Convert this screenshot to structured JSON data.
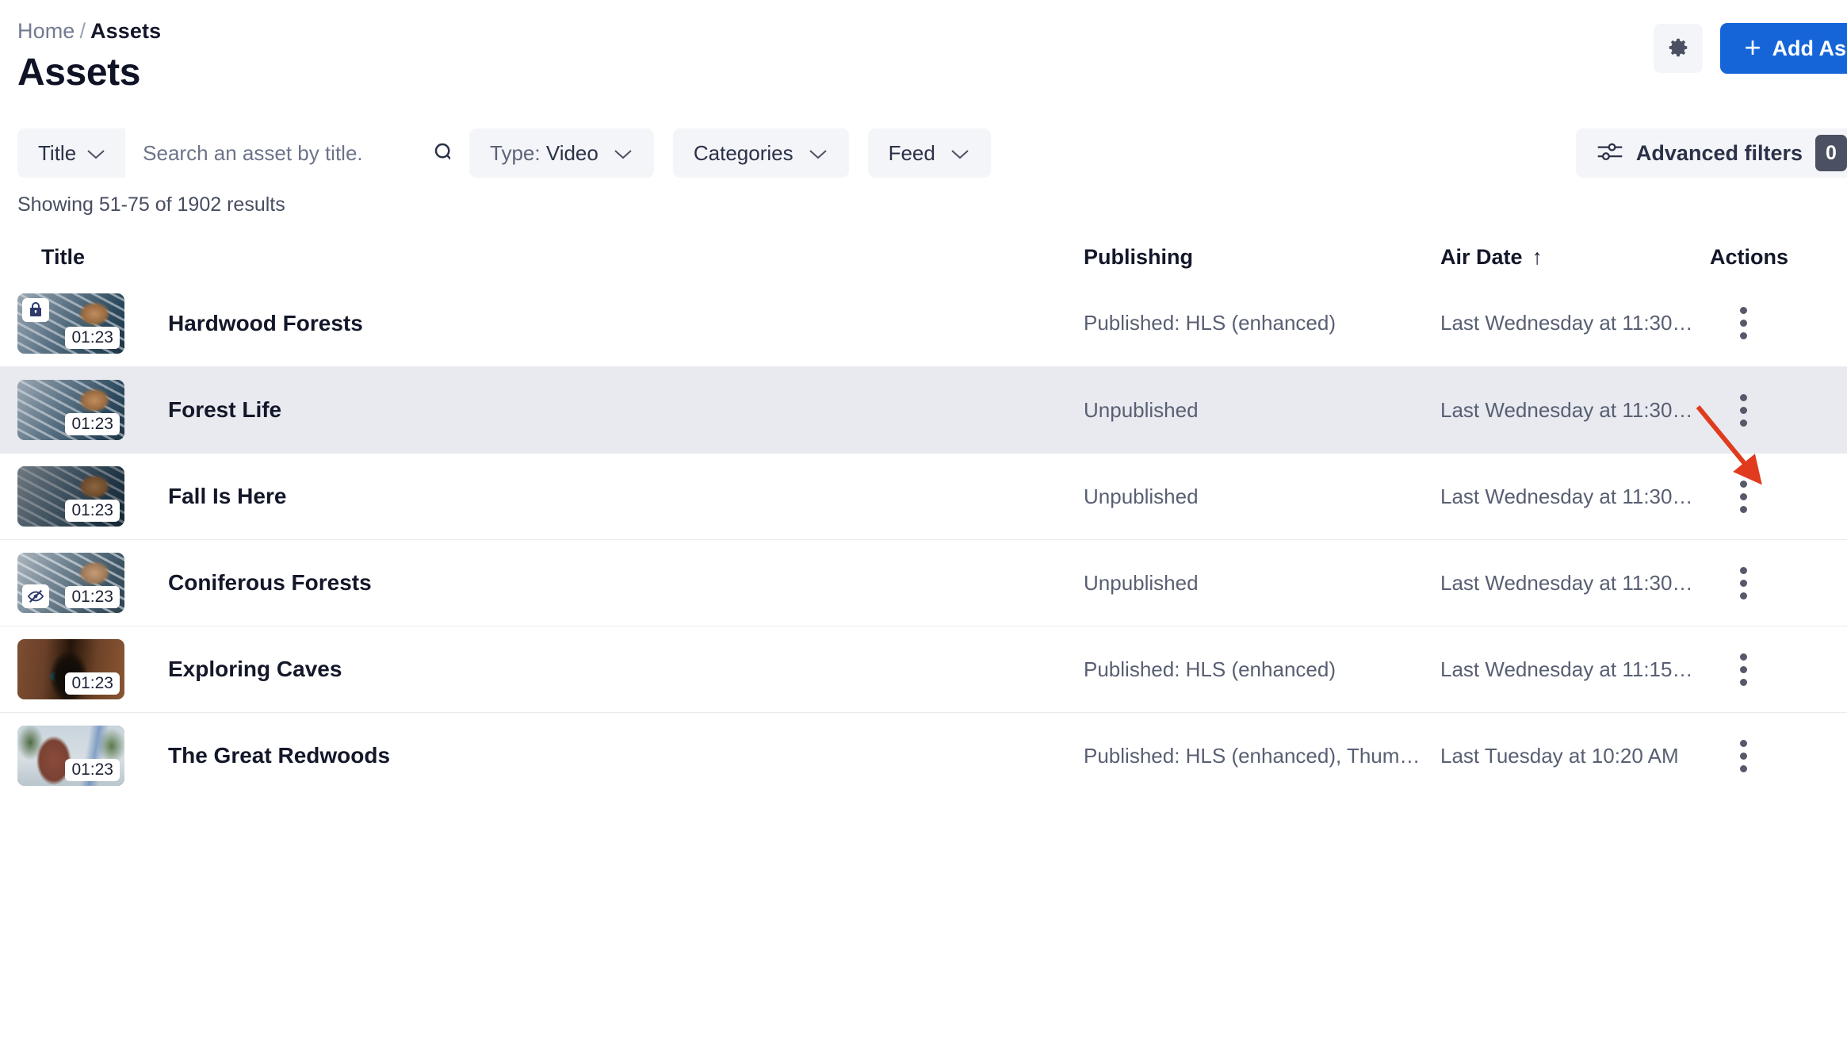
{
  "header": {
    "breadcrumb": {
      "home": "Home",
      "separator": "/",
      "current": "Assets"
    },
    "title": "Assets",
    "settings_icon": "gear-icon",
    "add_button": {
      "label": "Add Asset",
      "plus": "+",
      "color": "#1565d8"
    }
  },
  "filters": {
    "search": {
      "field_label": "Title",
      "placeholder": "Search an asset by title.",
      "value": "",
      "search_icon": "search-icon"
    },
    "chips": [
      {
        "name": "type",
        "prefix": "Type:",
        "value": "Video"
      },
      {
        "name": "categories",
        "prefix": "Categories",
        "value": ""
      },
      {
        "name": "feed",
        "prefix": "Feed",
        "value": ""
      }
    ],
    "advanced": {
      "label": "Advanced filters",
      "count": "0",
      "icon": "sliders-icon"
    }
  },
  "results_summary": "Showing 51-75 of 1902 results",
  "table": {
    "columns": [
      {
        "key": "title",
        "label": "Title"
      },
      {
        "key": "publishing",
        "label": "Publishing"
      },
      {
        "key": "air_date",
        "label": "Air Date",
        "sort": "ascending",
        "sort_glyph": "↑"
      },
      {
        "key": "actions",
        "label": "Actions"
      }
    ],
    "rows": [
      {
        "title": "Hardwood Forests",
        "publishing": "Published: HLS (enhanced)",
        "air_date": "Last Wednesday at 11:30…",
        "duration": "01:23",
        "thumb_style": "pinecone",
        "badge": "lock-icon",
        "badge_position": "top-left",
        "selected": false
      },
      {
        "title": "Forest Life",
        "publishing": "Unpublished",
        "air_date": "Last Wednesday at 11:30…",
        "duration": "01:23",
        "thumb_style": "pinecone",
        "badge": "",
        "badge_position": "",
        "selected": true
      },
      {
        "title": "Fall Is Here",
        "publishing": "Unpublished",
        "air_date": "Last Wednesday at 11:30…",
        "duration": "01:23",
        "thumb_style": "pinecone-dark",
        "badge": "",
        "badge_position": "",
        "selected": false
      },
      {
        "title": "Coniferous Forests",
        "publishing": "Unpublished",
        "air_date": "Last Wednesday at 11:30…",
        "duration": "01:23",
        "thumb_style": "pinecone-pale",
        "badge": "eye-off-icon",
        "badge_position": "bottom-left",
        "selected": false
      },
      {
        "title": "Exploring Caves",
        "publishing": "Published: HLS (enhanced)",
        "air_date": "Last Wednesday at 11:15…",
        "duration": "01:23",
        "thumb_style": "cave",
        "badge": "",
        "badge_position": "",
        "selected": false
      },
      {
        "title": "The Great Redwoods",
        "publishing": "Published: HLS (enhanced), Thum…",
        "air_date": "Last Tuesday at 10:20 AM",
        "duration": "01:23",
        "thumb_style": "redwood",
        "badge": "",
        "badge_position": "",
        "selected": false
      }
    ],
    "row_action_icon": "kebab-menu-icon"
  },
  "annotation": {
    "type": "arrow",
    "color": "#e03b1e",
    "points_to": "kebab-menu-icon of row Forest Life"
  }
}
